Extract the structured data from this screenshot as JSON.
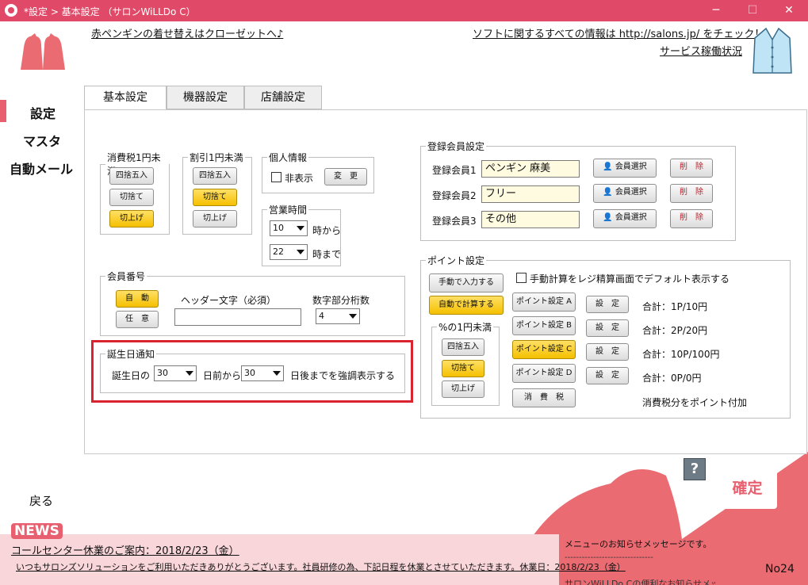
{
  "window": {
    "title": "*設定 > 基本設定 （サロンWiLLDo C）",
    "min": "─",
    "max": "☐",
    "close": "✕"
  },
  "header": {
    "closet_link": "赤ペンギンの着せ替えはクローゼットへ♪",
    "info_link": "ソフトに関するすべての情報は http://salons.jp/ をチェック！",
    "status_link": "サービス稼働状況"
  },
  "nav": {
    "settings": "設定",
    "master": "マスタ",
    "auto_mail": "自動メール",
    "back": "戻る"
  },
  "tabs": [
    "基本設定",
    "機器設定",
    "店舗設定"
  ],
  "tax_under_1yen": {
    "legend": "消費税1円未満",
    "options": [
      "四捨五入",
      "切捨て",
      "切上げ"
    ],
    "selected": "切上げ"
  },
  "discount_under_1yen": {
    "legend": "割引1円未満",
    "options": [
      "四捨五入",
      "切捨て",
      "切上げ"
    ],
    "selected": "切捨て"
  },
  "personal_info": {
    "legend": "個人情報",
    "hide_label": "非表示",
    "change_button": "変　更"
  },
  "business_hours": {
    "legend": "営業時間",
    "from_value": "10",
    "from_suffix": "時から",
    "to_value": "22",
    "to_suffix": "時まで"
  },
  "member_number": {
    "legend": "会員番号",
    "auto": "自　動",
    "manual": "任　意",
    "header_label": "ヘッダー文字（必須）",
    "header_value": "",
    "digits_label": "数字部分桁数",
    "digits_value": "4"
  },
  "birthday": {
    "legend": "誕生日通知",
    "prefix": "誕生日の",
    "before_value": "30",
    "before_suffix": "日前から",
    "after_value": "30",
    "after_suffix": "日後までを強調表示する"
  },
  "registered_members": {
    "legend": "登録会員設定",
    "rows": [
      {
        "label": "登録会員1",
        "value": "ペンギン 麻美"
      },
      {
        "label": "登録会員2",
        "value": "フリー"
      },
      {
        "label": "登録会員3",
        "value": "その他"
      }
    ],
    "select_button": "会員選択",
    "delete_button": "削　除"
  },
  "points": {
    "legend": "ポイント設定",
    "manual_input": "手動で入力する",
    "auto_calc": "自動で計算する",
    "default_checkbox": "手動計算をレジ精算画面でデフォルト表示する",
    "under_1yen_legend": "%の1円未満",
    "rounding": [
      "四捨五入",
      "切捨て",
      "切上げ"
    ],
    "rounding_selected": "切捨て",
    "settings": [
      {
        "name": "ポイント設定 A",
        "set": "設　定",
        "total": "合計：1P/10円"
      },
      {
        "name": "ポイント設定 B",
        "set": "設　定",
        "total": "合計：2P/20円"
      },
      {
        "name": "ポイント設定 C",
        "set": "設　定",
        "total": "合計：10P/100円"
      },
      {
        "name": "ポイント設定 D",
        "set": "設　定",
        "total": "合計：0P/0円"
      }
    ],
    "tax_button": "消　費　税",
    "tax_note": "消費税分をポイント付加"
  },
  "help": "?",
  "confirm": "確定",
  "news": {
    "badge": "NEWS",
    "headline": "コールセンター休業のご案内：2018/2/23（金）",
    "body": "いつもサロンズソリューションをご利用いただきありがとうございます。社員研修の為、下記日程を休業とさせていただきます。休業日：2018/2/23（金）",
    "menu_msg": "メニューのお知らせメッセージです。",
    "dashes": "-------------------------------",
    "cut_text": "サロンWiLLDo Cの便利なお知らせメッセージ",
    "number": "No24"
  },
  "colors": {
    "title_bar": "#e04a68",
    "accent_pink": "#e8606f",
    "selected_button": "#f5c000",
    "highlight_border": "#d9242f"
  }
}
